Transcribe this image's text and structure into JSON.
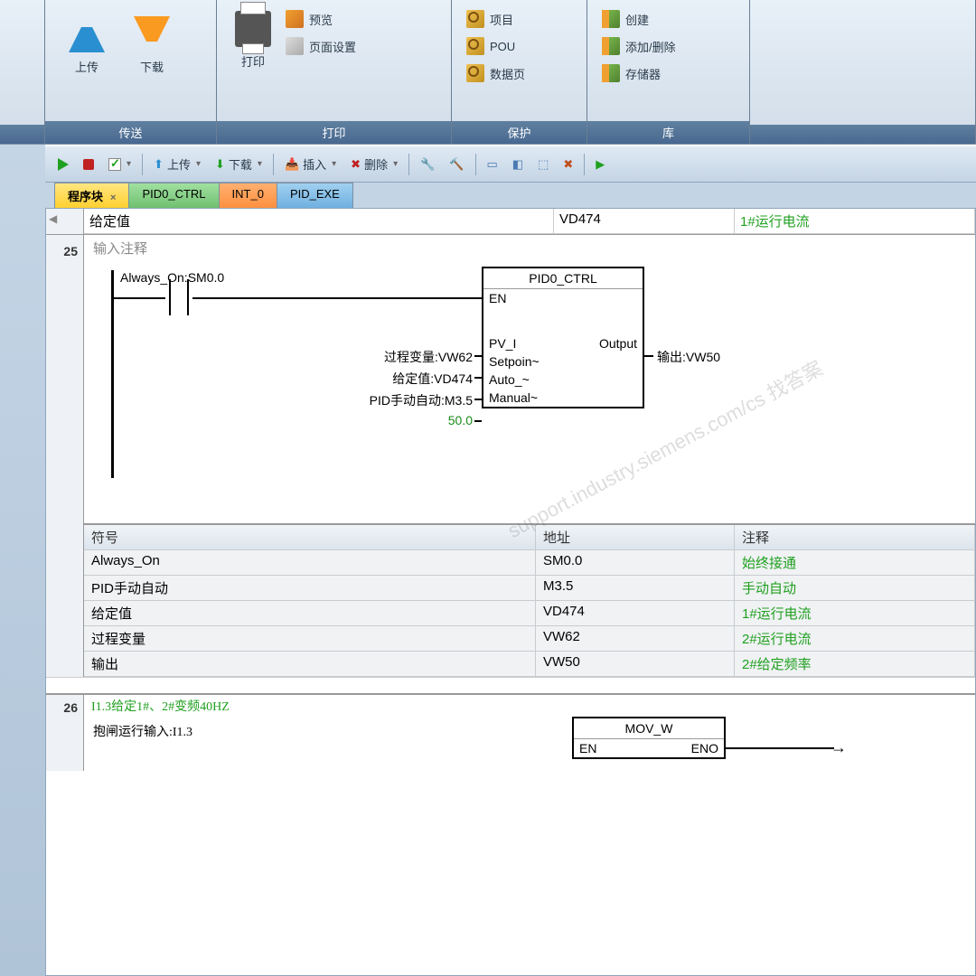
{
  "ribbon": {
    "g1": {
      "label": "传送",
      "upload": "上传",
      "download": "下载"
    },
    "g2": {
      "label": "打印",
      "print": "打印",
      "preview": "预览",
      "pagesetup": "页面设置"
    },
    "g3": {
      "label": "保护",
      "project": "项目",
      "pou": "POU",
      "datapage": "数据页"
    },
    "g4": {
      "label": "库",
      "create": "创建",
      "addremove": "添加/删除",
      "memory": "存储器"
    }
  },
  "toolbar": {
    "upload": "上传",
    "download": "下载",
    "insert": "插入",
    "delete": "删除"
  },
  "tabs": {
    "t1": "程序块",
    "t1x": "×",
    "t2": "PID0_CTRL",
    "t3": "INT_0",
    "t4": "PID_EXE"
  },
  "headerRow": {
    "c1": "给定值",
    "c2": "VD474",
    "c3": "1#运行电流"
  },
  "network25": {
    "num": "25",
    "title": "输入注释",
    "contact": "Always_On:SM0.0",
    "block": {
      "title": "PID0_CTRL",
      "en": "EN",
      "pv": "PV_I",
      "pv_val": "过程变量:VW62",
      "sp": "Setpoin~",
      "sp_val": "给定值:VD474",
      "auto": "Auto_~",
      "auto_val": "PID手动自动:M3.5",
      "man": "Manual~",
      "man_val": "50.0",
      "out": "Output",
      "out_val": "输出:VW50"
    }
  },
  "symtable": {
    "h1": "符号",
    "h2": "地址",
    "h3": "注释",
    "rows": [
      {
        "s": "Always_On",
        "a": "SM0.0",
        "c": "始终接通"
      },
      {
        "s": "PID手动自动",
        "a": "M3.5",
        "c": "手动自动"
      },
      {
        "s": "给定值",
        "a": "VD474",
        "c": "1#运行电流"
      },
      {
        "s": "过程变量",
        "a": "VW62",
        "c": "2#运行电流"
      },
      {
        "s": "输出",
        "a": "VW50",
        "c": "2#给定频率"
      }
    ]
  },
  "network26": {
    "num": "26",
    "title": "I1.3给定1#、2#变频40HZ",
    "contact": "抱闸运行输入:I1.3",
    "block": "MOV_W",
    "en": "EN",
    "eno": "ENO"
  },
  "watermark": "support.industry.siemens.com/cs 找答案"
}
